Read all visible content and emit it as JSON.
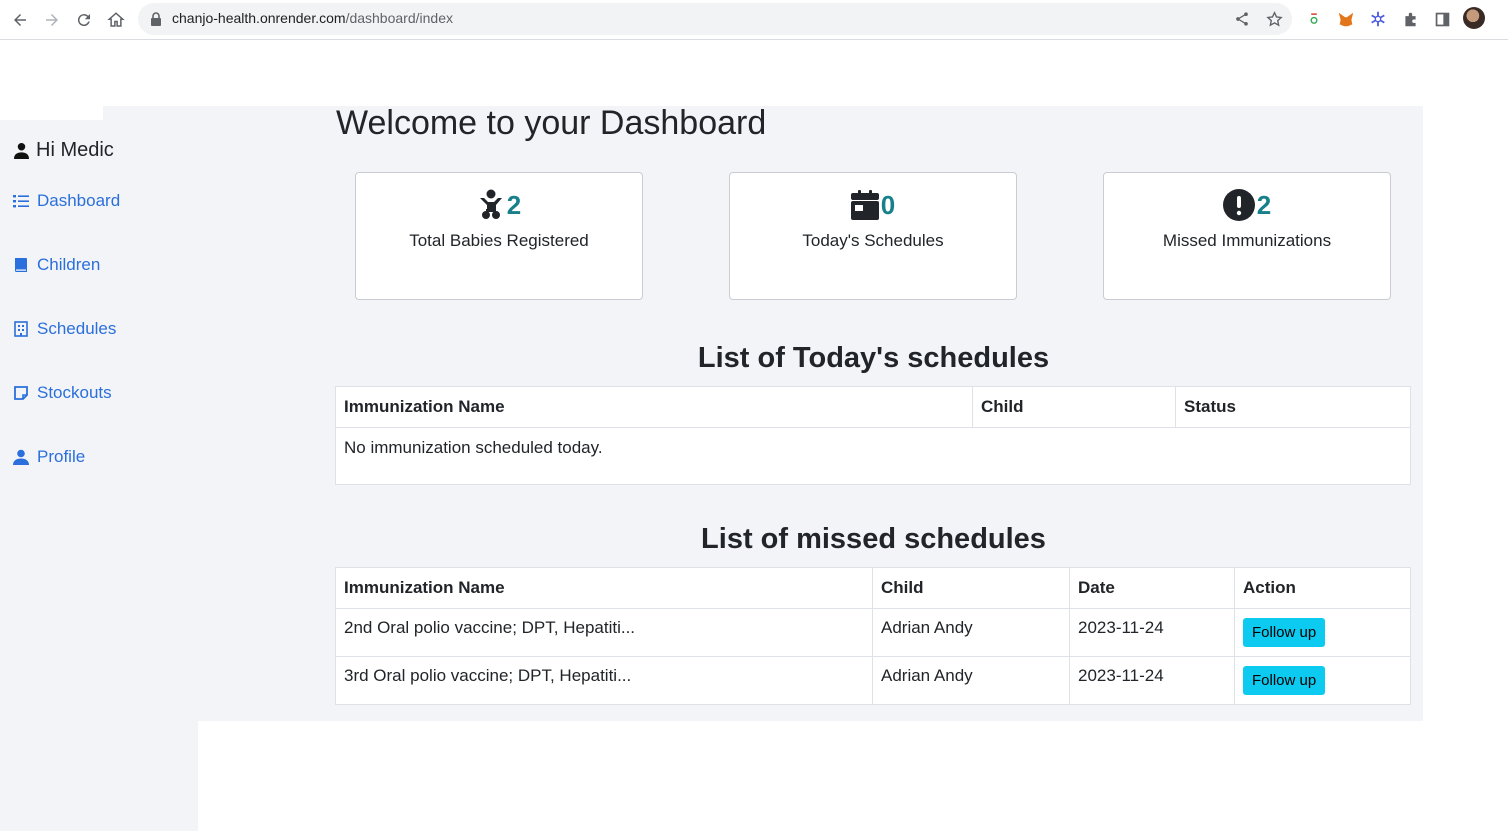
{
  "browser": {
    "url_host": "chanjo-health.onrender.com",
    "url_path": "/dashboard/index"
  },
  "sidebar": {
    "greeting": "Hi Medic",
    "items": [
      {
        "label": "Dashboard",
        "icon": "list-icon"
      },
      {
        "label": "Children",
        "icon": "book-icon"
      },
      {
        "label": "Schedules",
        "icon": "building-icon"
      },
      {
        "label": "Stockouts",
        "icon": "note-icon"
      },
      {
        "label": "Profile",
        "icon": "user-icon"
      }
    ]
  },
  "main": {
    "title": "Welcome to your Dashboard",
    "cards": [
      {
        "value": "2",
        "label": "Total Babies Registered",
        "icon": "baby-icon"
      },
      {
        "value": "0",
        "label": "Today's Schedules",
        "icon": "calendar-icon"
      },
      {
        "value": "2",
        "label": "Missed Immunizations",
        "icon": "exclamation-icon"
      }
    ],
    "today": {
      "title": "List of Today's schedules",
      "headers": [
        "Immunization Name",
        "Child",
        "Status"
      ],
      "empty_text": "No immunization scheduled today."
    },
    "missed": {
      "title": "List of missed schedules",
      "headers": [
        "Immunization Name",
        "Child",
        "Date",
        "Action"
      ],
      "rows": [
        {
          "name": "2nd Oral polio vaccine; DPT, Hepatiti...",
          "child": "Adrian Andy",
          "date": "2023-11-24",
          "action": "Follow up"
        },
        {
          "name": "3rd Oral polio vaccine; DPT, Hepatiti...",
          "child": "Adrian Andy",
          "date": "2023-11-24",
          "action": "Follow up"
        }
      ]
    }
  },
  "colors": {
    "link": "#2a6fdb",
    "count": "#17808a",
    "button": "#0dcaf0",
    "panel": "#f3f4f8"
  }
}
